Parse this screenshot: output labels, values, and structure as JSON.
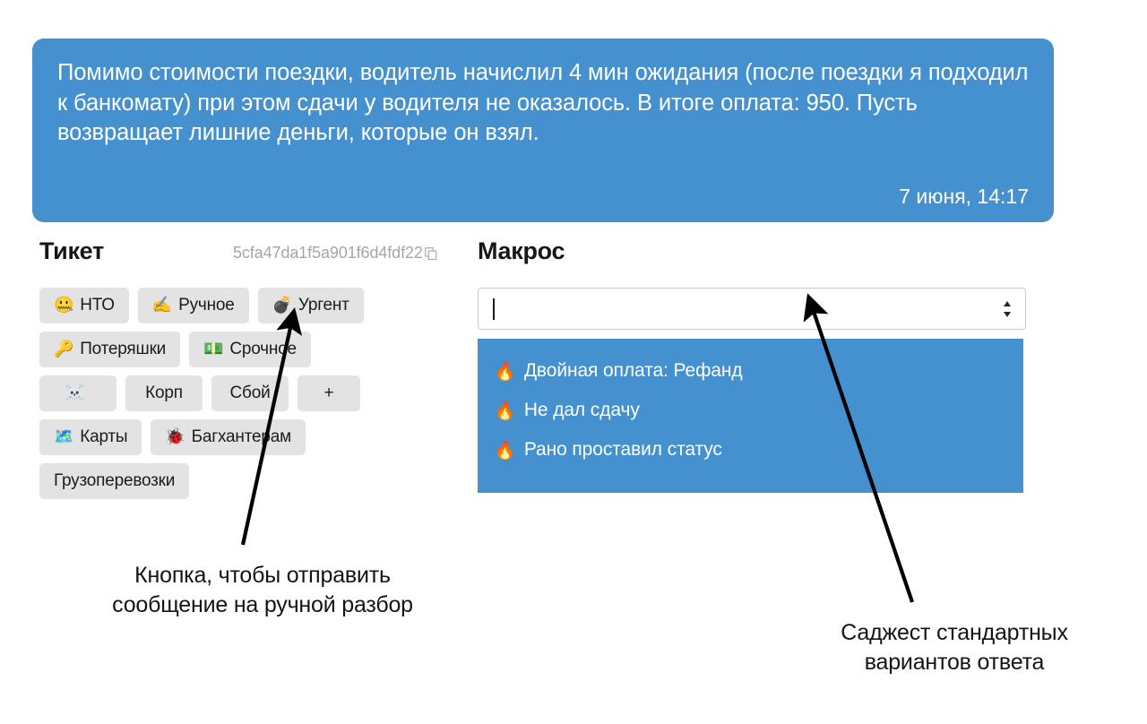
{
  "message": {
    "text": "Помимо стоимости поездки, водитель начислил 4 мин ожидания (после поездки я подходил к банкомату) при этом сдачи у водителя не оказалось. В итоге оплата: 950. Пусть возвращает лишние деньги, которые он взял.",
    "time": "7 июня, 14:17",
    "bubble_color": "#4590ce",
    "text_color": "#ffffff"
  },
  "ticket": {
    "title": "Тикет",
    "hash": "5cfa47da1f5a901f6d4fdf22",
    "copy_icon": "copy-icon",
    "tag_rows": [
      [
        {
          "emoji": "🤐",
          "label": "НТО",
          "icon_name": "zipper-mouth-face-icon"
        },
        {
          "emoji": "✍️",
          "label": "Ручное",
          "icon_name": "writing-hand-icon"
        },
        {
          "emoji": "💣",
          "label": "Ургент",
          "icon_name": "bomb-icon"
        }
      ],
      [
        {
          "emoji": "🔑",
          "label": "Потеряшки",
          "icon_name": "key-icon"
        },
        {
          "emoji": "💵",
          "label": "Срочное",
          "icon_name": "banknote-icon"
        }
      ],
      [
        {
          "emoji": "☠️",
          "label": "",
          "icon_name": "skull-and-crossbones-icon"
        },
        {
          "emoji": "",
          "label": "Корп",
          "icon_name": ""
        },
        {
          "emoji": "",
          "label": "Сбой",
          "icon_name": ""
        },
        {
          "emoji": "",
          "label": "+",
          "icon_name": ""
        }
      ],
      [
        {
          "emoji": "🗺️",
          "label": "Карты",
          "icon_name": "map-icon"
        },
        {
          "emoji": "🐞",
          "label": "Багхантерам",
          "icon_name": "ladybug-icon"
        }
      ],
      [
        {
          "emoji": "",
          "label": "Грузоперевозки",
          "icon_name": ""
        }
      ]
    ]
  },
  "macro": {
    "title": "Макрос",
    "input_value": "",
    "input_placeholder": "",
    "spinner_icon": "updown-spinner-icon",
    "suggestions": [
      {
        "emoji": "🔥",
        "label": "Двойная оплата: Рефанд",
        "icon_name": "fire-icon"
      },
      {
        "emoji": "🔥",
        "label": "Не дал сдачу",
        "icon_name": "fire-icon"
      },
      {
        "emoji": "🔥",
        "label": "Рано проставил статус",
        "icon_name": "fire-icon"
      }
    ],
    "suggest_bg_color": "#4590ce"
  },
  "annotations": {
    "left_caption": "Кнопка, чтобы отправить\nсообщение на ручной разбор",
    "right_caption": "Саджест стандартных\nвариантов ответа",
    "arrow_color": "#000000"
  }
}
